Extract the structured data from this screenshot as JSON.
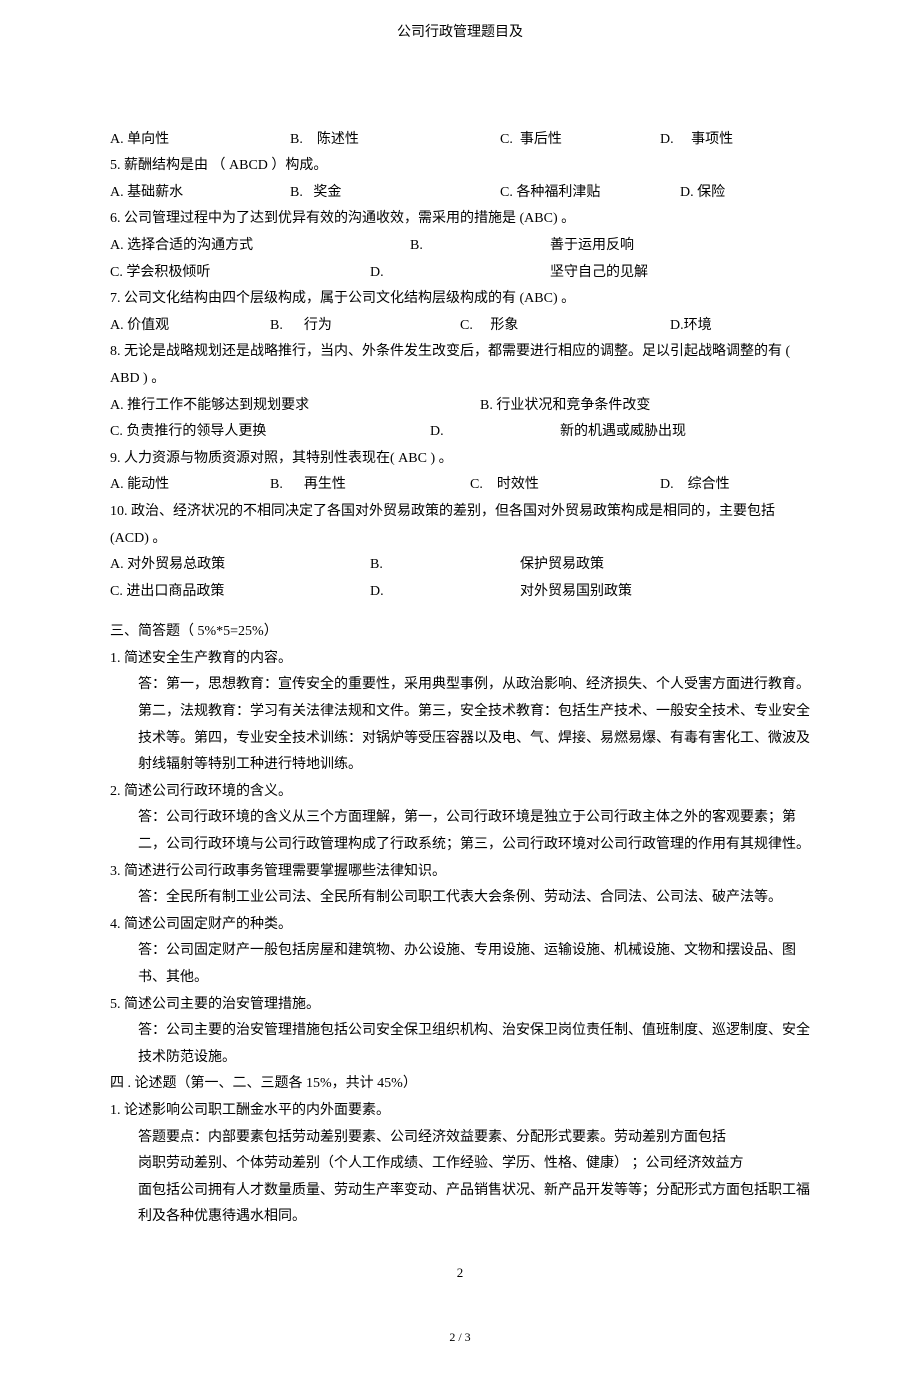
{
  "header": {
    "title": "公司行政管理题目及"
  },
  "q4_opts": {
    "a": "A. 单向性",
    "b": "B.    陈述性",
    "c": "C.  事后性",
    "d": "D.     事项性"
  },
  "q5": "5. 薪酬结构是由 （ ABCD ）构成。",
  "q5_opts": {
    "a": "A. 基础薪水",
    "b": "B.   奖金",
    "c": "C. 各种福利津贴",
    "d": "D. 保险"
  },
  "q6": "6. 公司管理过程中为了达到优异有效的沟通收效，需采用的措施是         (ABC) 。",
  "q6a": "A. 选择合适的沟通方式",
  "q6b": "B.",
  "q6b_t": "善于运用反响",
  "q6c": "C. 学会积极倾听",
  "q6d": "D.",
  "q6d_t": "坚守自己的见解",
  "q7": "7. 公司文化结构由四个层级构成，属于公司文化结构层级构成的有           (ABC) 。",
  "q7_opts": {
    "a": "A. 价值观",
    "b": "B.      行为",
    "c": "C.     形象",
    "d": "D.环境"
  },
  "q8": "8.  无论是战略规划还是战略推行，当内、外条件发生改变后，都需要进行相应的调整。足以引起战略调整的有 ( ABD ) 。",
  "q8a": "A. 推行工作不能够达到规划要求",
  "q8b": "B. 行业状况和竞争条件改变",
  "q8c": "C. 负责推行的领导人更换",
  "q8d": "D.",
  "q8d_t": "新的机遇或威胁出现",
  "q9": "9. 人力资源与物质资源对照，其特别性表现在( ABC )  。",
  "q9_opts": {
    "a": "A. 能动性",
    "b": "B.      再生性",
    "c": "C.    时效性",
    "d": "D.    综合性"
  },
  "q10": "10. 政治、经济状况的不相同决定了各国对外贸易政策的差别，但各国对外贸易政策构成是相同的，主要包括 (ACD) 。",
  "q10a": "A. 对外贸易总政策",
  "q10b": "B.",
  "q10b_t": "保护贸易政策",
  "q10c": "C. 进出口商品政策",
  "q10d": "D.",
  "q10d_t": "对外贸易国别政策",
  "sec3": "三、简答题（  5%*5=25%）",
  "s3q1": "1. 简述安全生产教育的内容。",
  "s3a1": "答：第一，思想教育：宣传安全的重要性，采用典型事例，从政治影响、经济损失、个人受害方面进行教育。第二，法规教育：学习有关法律法规和文件。第三，安全技术教育：包括生产技术、一般安全技术、专业安全技术等。第四，专业安全技术训练：对锅炉等受压容器以及电、气、焊接、易燃易爆、有毒有害化工、微波及射线辐射等特别工种进行特地训练。",
  "s3q2": "2. 简述公司行政环境的含义。",
  "s3a2": "答：公司行政环境的含义从三个方面理解，第一，公司行政环境是独立于公司行政主体之外的客观要素；第二，公司行政环境与公司行政管理构成了行政系统；第三，公司行政环境对公司行政管理的作用有其规律性。",
  "s3q3": "3. 简述进行公司行政事务管理需要掌握哪些法律知识。",
  "s3a3": "答：全民所有制工业公司法、全民所有制公司职工代表大会条例、劳动法、合同法、公司法、破产法等。",
  "s3q4": "4. 简述公司固定财产的种类。",
  "s3a4": "答：公司固定财产一般包括房屋和建筑物、办公设施、专用设施、运输设施、机械设施、文物和摆设品、图书、其他。",
  "s3q5": "5. 简述公司主要的治安管理措施。",
  "s3a5": "答：公司主要的治安管理措施包括公司安全保卫组织机构、治安保卫岗位责任制、值班制度、巡逻制度、安全技术防范设施。",
  "sec4": "四 . 论述题（第一、二、三题各    15%，共计 45%）",
  "s4q1": "1. 论述影响公司职工酬金水平的内外面要素。",
  "s4a1a": "答题要点：内部要素包括劳动差别要素、公司经济效益要素、分配形式要素。劳动差别方面包括",
  "s4a1b": "岗职劳动差别、个体劳动差别（个人工作成绩、工作经验、学历、性格、健康）            ；公司经济效益方",
  "s4a1c": "面包括公司拥有人才数量质量、劳动生产率变动、产品销售状况、新产品开发等等；分配形式方面包括职工福利及各种优惠待遇水相同。",
  "page_number_top": "2",
  "footer": "2 / 3"
}
